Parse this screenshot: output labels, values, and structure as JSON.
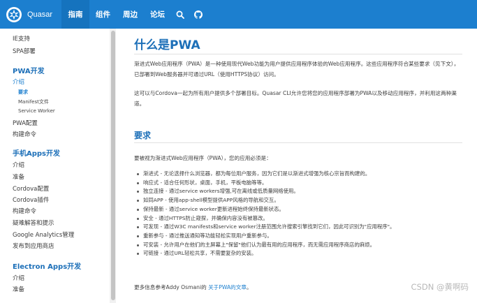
{
  "header": {
    "brand_name": "Quasar",
    "nav": [
      "指南",
      "组件",
      "周边",
      "论坛"
    ],
    "icons": [
      "quasar-logo-icon",
      "search-icon",
      "github-icon"
    ],
    "colors": {
      "bar": "#1c7fcf",
      "active": "#1573be"
    }
  },
  "sidebar": {
    "items": [
      {
        "text": "IE支持",
        "kind": "item"
      },
      {
        "text": "SPA部署",
        "kind": "item"
      },
      {
        "text": "PWA开发",
        "kind": "group"
      },
      {
        "text": "介绍",
        "kind": "item"
      },
      {
        "text": "要求",
        "kind": "sub"
      },
      {
        "text": "Manifest文件",
        "kind": "sub"
      },
      {
        "text": "Service Worker",
        "kind": "sub"
      },
      {
        "text": "PWA配置",
        "kind": "item"
      },
      {
        "text": "构建命令",
        "kind": "item"
      },
      {
        "text": "手机Apps开发",
        "kind": "group"
      },
      {
        "text": "介绍",
        "kind": "item"
      },
      {
        "text": "准备",
        "kind": "item"
      },
      {
        "text": "Cordova配置",
        "kind": "item"
      },
      {
        "text": "Cordova插件",
        "kind": "item"
      },
      {
        "text": "构建命令",
        "kind": "item"
      },
      {
        "text": "疑难解答和提示",
        "kind": "item"
      },
      {
        "text": "Google Analytics管理",
        "kind": "item"
      },
      {
        "text": "发布到应用商店",
        "kind": "item"
      },
      {
        "text": "Electron Apps开发",
        "kind": "group"
      },
      {
        "text": "介绍",
        "kind": "item"
      },
      {
        "text": "准备",
        "kind": "item"
      }
    ]
  },
  "main": {
    "title": "什么是PWA",
    "intro_1": "渐进式Web应用程序（PWA）是一种使用现代Web功能为用户提供应用程序体验的Web应用程序。这些应用程序符合某些要求（见下文），已部署到Web服务器并可通过URL（使用HTTPS协议）访问。",
    "intro_2": "这可以与Cordova一起为所有用户提供多个部署目标。Quasar CLI允许您将您的应用程序部署为PWA以及移动应用程序，并利用这两种渠道。",
    "req_title": "要求",
    "req_lead": "要被视为渐进式Web应用程序（PWA），您的应用必须是：",
    "requirements": [
      "渐进式 - 无论选择什么浏览器，都为每位用户服务，因为它们是以渐进式增强为核心宗旨而构建的。",
      "响应式 - 适合任何形状，桌面，手机，平板电脑等等。",
      "独立连接 - 通过service workers增强,可在离线或低质量网络使用。",
      "如同APP - 使用app-shell模型提供APP风格的导航和交互。",
      "保持最新 - 通过service worker更新进程始终保持最新状态。",
      "安全 - 通过HTTPS防止窥探，并确保内容没有被篡改。",
      "可发现 - 通过W3C manifests和service worker注册范围允许搜索引擎找到它们，因此可识别为\"应用程序\"。",
      "重新参与 - 通过推送通知等功能轻松实现用户重新参与。",
      "可安装 - 允许用户在他们的主屏幕上\"保留\"他们认为最有用的应用程序，而无需应用程序商店的麻烦。",
      "可链接 - 通过URL轻松共享，不需要复杂的安装。"
    ],
    "more_prefix": "更多信息参考Addy Osmani的 ",
    "more_link": "关于PWA的文章",
    "more_suffix": "。"
  },
  "watermark": "CSDN @黄啊码"
}
